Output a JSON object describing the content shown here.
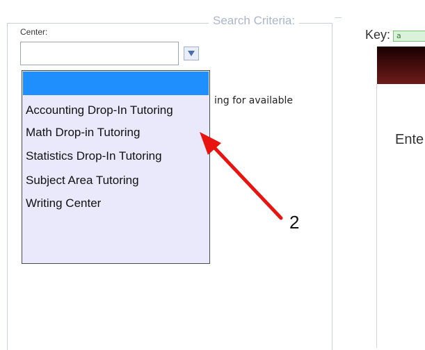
{
  "search_criteria": {
    "legend": "Search Criteria:",
    "center_label": "Center:",
    "center_value": "",
    "hint_fragment": "ing for available",
    "options": [
      {
        "label": "",
        "selected": true
      },
      {
        "label": "Accounting Drop-In Tutoring",
        "selected": false
      },
      {
        "label": "Math Drop-in Tutoring",
        "selected": false
      },
      {
        "label": "Statistics Drop-In Tutoring",
        "selected": false
      },
      {
        "label": "Subject Area Tutoring",
        "selected": false
      },
      {
        "label": "Writing Center",
        "selected": false
      }
    ]
  },
  "key": {
    "label": "Key:",
    "swatch_text": "a"
  },
  "right_panel": {
    "enter_text": "Ente"
  },
  "annotation": {
    "number": "2",
    "color": "#e8140f"
  },
  "colors": {
    "selected_option": "#1e8ffc",
    "listbox_bg": "#e9e9fb",
    "panel_border": "#c7d0e0"
  },
  "icons": {
    "dropdown": "triangle-down-icon",
    "arrow": "red-arrow-icon"
  }
}
